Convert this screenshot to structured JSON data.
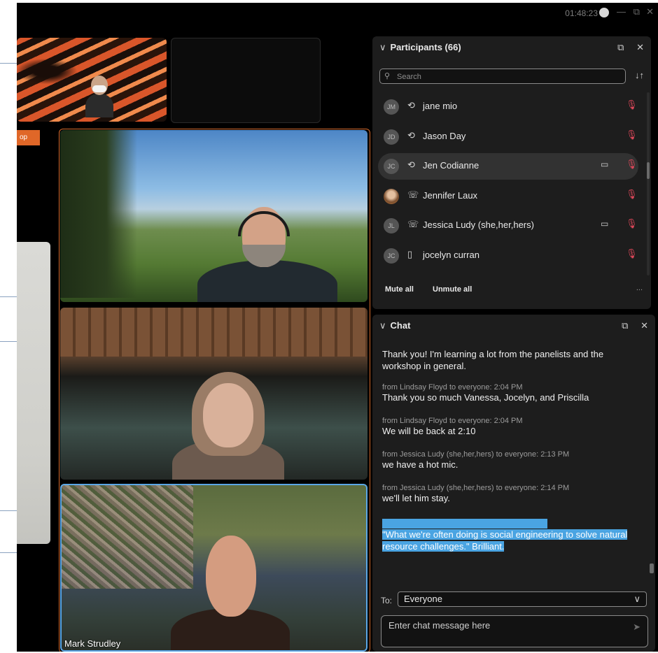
{
  "titlebar": {
    "time": "01:48:23",
    "min_glyph": "—",
    "restore_glyph": "⧉",
    "close_glyph": "✕"
  },
  "tiles": {
    "left_tab_label": "op",
    "bottom_tile_name": "Mark Strudley"
  },
  "participants": {
    "title": "Participants (66)",
    "search_placeholder": "Search",
    "chevron": "∨",
    "popout_glyph": "⧉",
    "close_glyph": "✕",
    "sort_glyph": "↓↑",
    "search_glyph": "⚲",
    "items": [
      {
        "initials": "JM",
        "name": "jane mio",
        "status_icon": "headset-icon",
        "status_glyph": "⟲",
        "camera": false,
        "mic_glyph": "🎙"
      },
      {
        "initials": "JD",
        "name": "Jason Day",
        "status_icon": "headset-icon",
        "status_glyph": "⟲",
        "camera": false,
        "mic_glyph": "🎙"
      },
      {
        "initials": "JC",
        "name": "Jen Codianne",
        "status_icon": "headset-icon",
        "status_glyph": "⟲",
        "camera": true,
        "cam_glyph": "▭",
        "mic_glyph": "🎙"
      },
      {
        "initials": "",
        "name": "Jennifer Laux",
        "status_icon": "phone-icon",
        "status_glyph": "☏",
        "camera": false,
        "mic_glyph": "🎙",
        "photo": true
      },
      {
        "initials": "JL",
        "name": "Jessica Ludy (she,her,hers)",
        "status_icon": "phone-icon",
        "status_glyph": "☏",
        "camera": true,
        "cam_glyph": "▭",
        "mic_glyph": "🎙"
      },
      {
        "initials": "JC",
        "name": "jocelyn curran",
        "status_icon": "mobile-icon",
        "status_glyph": "▯",
        "camera": false,
        "mic_glyph": "🎙"
      }
    ],
    "mute_all": "Mute all",
    "unmute_all": "Unmute all",
    "more": "..."
  },
  "chat": {
    "title": "Chat",
    "chevron": "∨",
    "popout_glyph": "⧉",
    "close_glyph": "✕",
    "messages": [
      {
        "meta": "",
        "text": "Thank you! I'm learning a lot from the panelists and the workshop in general."
      },
      {
        "meta": "from Lindsay Floyd to everyone:   2:04 PM",
        "text": "Thank you so much Vanessa, Jocelyn, and Priscilla"
      },
      {
        "meta": "from Lindsay Floyd to everyone:   2:04 PM",
        "text": "We will be back at 2:10"
      },
      {
        "meta": "from Jessica Ludy (she,her,hers) to everyone:   2:13 PM",
        "text": "we have a hot mic."
      },
      {
        "meta": "from Jessica Ludy (she,her,hers) to everyone:   2:14 PM",
        "text": "we'll let him stay."
      },
      {
        "meta": "",
        "text": "\"What we're often doing is social engineering to solve natural resource challenges.\"     Brilliant."
      }
    ],
    "to_label": "To:",
    "to_value": "Everyone",
    "to_chevron": "∨",
    "input_placeholder": "Enter chat message here",
    "send_glyph": "➤"
  },
  "colors": {
    "accent_orange": "#d76a2b",
    "selected_blue": "#5aa6e6",
    "mic_muted_red": "#e0485a",
    "highlight_blue": "#4aa4e2"
  }
}
